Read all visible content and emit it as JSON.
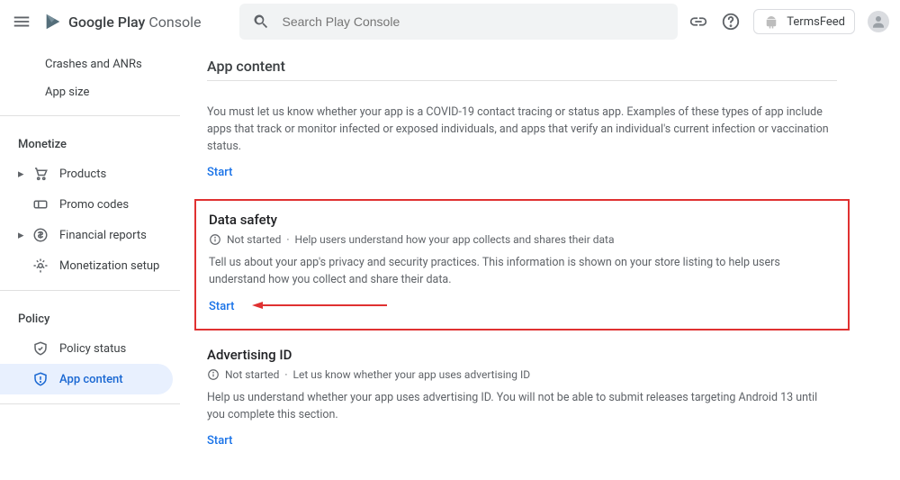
{
  "header": {
    "logo_main": "Google Play",
    "logo_sub": " Console",
    "search_placeholder": "Search Play Console",
    "user_label": "TermsFeed"
  },
  "sidebar": {
    "items_top": [
      {
        "label": "Crashes and ANRs"
      },
      {
        "label": "App size"
      }
    ],
    "monetize_label": "Monetize",
    "monetize_items": [
      {
        "label": "Products"
      },
      {
        "label": "Promo codes"
      },
      {
        "label": "Financial reports"
      },
      {
        "label": "Monetization setup"
      }
    ],
    "policy_label": "Policy",
    "policy_items": [
      {
        "label": "Policy status"
      },
      {
        "label": "App content"
      }
    ]
  },
  "main": {
    "page_title": "App content",
    "covid": {
      "desc": "You must let us know whether your app is a COVID-19 contact tracing or status app. Examples of these types of app include apps that track or monitor infected or exposed individuals, and apps that verify an individual's current infection or vaccination status.",
      "start": "Start"
    },
    "data_safety": {
      "title": "Data safety",
      "status": "Not started",
      "hint": "Help users understand how your app collects and shares their data",
      "desc": "Tell us about your app's privacy and security practices. This information is shown on your store listing to help users understand how you collect and share their data.",
      "start": "Start"
    },
    "advertising": {
      "title": "Advertising ID",
      "status": "Not started",
      "hint": "Let us know whether your app uses advertising ID",
      "desc": "Help us understand whether your app uses advertising ID. You will not be able to submit releases targeting Android 13 until you complete this section.",
      "start": "Start"
    }
  }
}
